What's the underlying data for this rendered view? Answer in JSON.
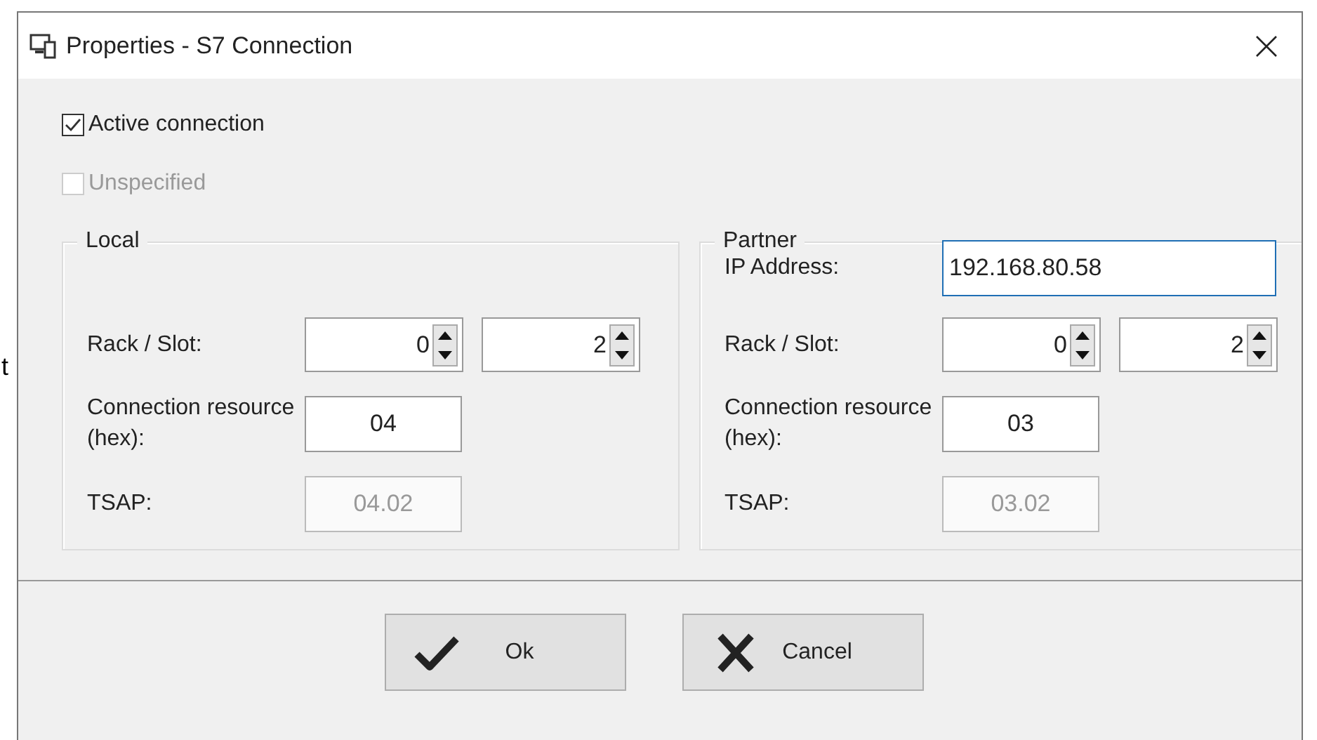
{
  "background_text": "t",
  "window": {
    "title": "Properties - S7 Connection"
  },
  "options": [
    {
      "label": "Active connection",
      "checked": true,
      "disabled": false
    },
    {
      "label": "Unspecified",
      "checked": false,
      "disabled": true
    }
  ],
  "groups": [
    {
      "title": "Local",
      "rows": [
        {
          "kind": "spin",
          "label": "Rack / Slot:",
          "values": [
            "0",
            "2"
          ]
        },
        {
          "kind": "field",
          "label": "Connection resource (hex):",
          "value": "04",
          "disabled": false
        },
        {
          "kind": "field",
          "label": "TSAP:",
          "value": "04.02",
          "disabled": true
        }
      ]
    },
    {
      "title": "Partner",
      "rows": [
        {
          "kind": "text",
          "label": "IP Address:",
          "value": "192.168.80.58"
        },
        {
          "kind": "spin",
          "label": "Rack / Slot:",
          "values": [
            "0",
            "2"
          ]
        },
        {
          "kind": "field",
          "label": "Connection resource (hex):",
          "value": "03",
          "disabled": false
        },
        {
          "kind": "field",
          "label": "TSAP:",
          "value": "03.02",
          "disabled": true
        }
      ]
    }
  ],
  "buttons": [
    {
      "kind": "ok",
      "label": "Ok"
    },
    {
      "kind": "cancel",
      "label": "Cancel"
    }
  ]
}
